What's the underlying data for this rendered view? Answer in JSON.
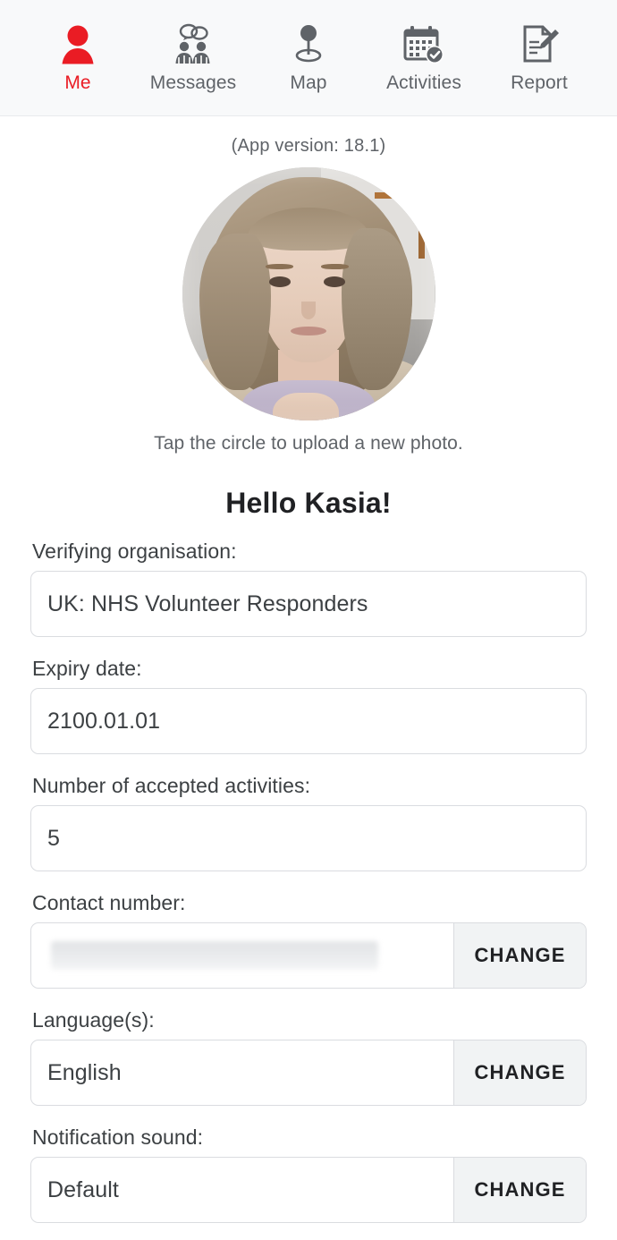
{
  "nav": {
    "items": [
      {
        "label": "Me",
        "icon": "person-icon",
        "active": true
      },
      {
        "label": "Messages",
        "icon": "people-chat-icon",
        "active": false
      },
      {
        "label": "Map",
        "icon": "map-pin-icon",
        "active": false
      },
      {
        "label": "Activities",
        "icon": "calendar-check-icon",
        "active": false
      },
      {
        "label": "Report",
        "icon": "document-pen-icon",
        "active": false
      }
    ],
    "active_color": "#ea1c24",
    "inactive_color": "#5f6368"
  },
  "header": {
    "app_version": "(App version: 18.1)",
    "avatar_hint": "Tap the circle to upload a new photo.",
    "greeting": "Hello Kasia!"
  },
  "fields": [
    {
      "label": "Verifying organisation:",
      "value": "UK: NHS Volunteer Responders",
      "has_change": false,
      "redacted": false
    },
    {
      "label": "Expiry date:",
      "value": "2100.01.01",
      "has_change": false,
      "redacted": false
    },
    {
      "label": "Number of accepted activities:",
      "value": "5",
      "has_change": false,
      "redacted": false
    },
    {
      "label": "Contact number:",
      "value": "",
      "has_change": true,
      "change_label": "CHANGE",
      "redacted": true
    },
    {
      "label": "Language(s):",
      "value": "English",
      "has_change": true,
      "change_label": "CHANGE",
      "redacted": false
    },
    {
      "label": "Notification sound:",
      "value": "Default",
      "has_change": true,
      "change_label": "CHANGE",
      "redacted": false
    }
  ]
}
